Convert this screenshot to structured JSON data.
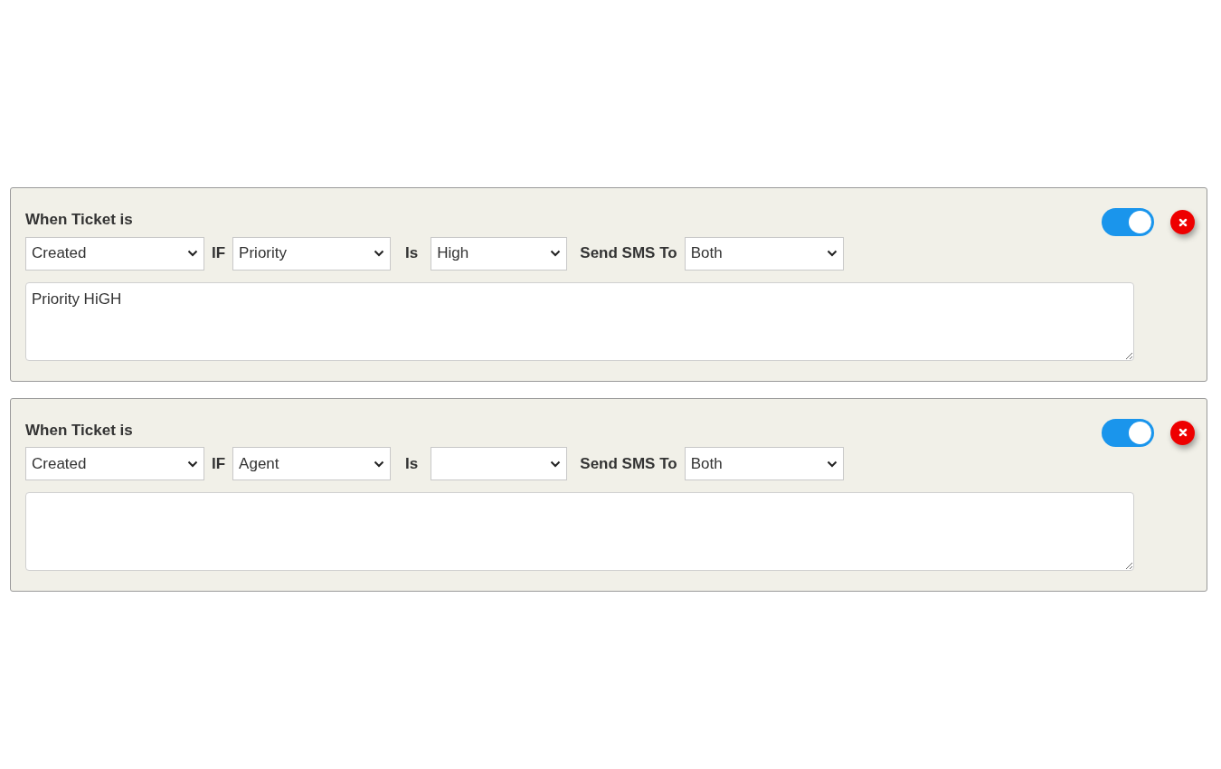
{
  "rules": [
    {
      "heading": "When Ticket is",
      "event": "Created",
      "if_label": "IF",
      "field": "Priority",
      "is_label": "Is",
      "value": "High",
      "send_label": "Send SMS To",
      "recipient": "Both",
      "message": "Priority HiGH",
      "enabled": true
    },
    {
      "heading": "When Ticket is",
      "event": "Created",
      "if_label": "IF",
      "field": "Agent",
      "is_label": "Is",
      "send_label": "Send SMS To",
      "recipient": "Both",
      "enabled": true
    }
  ]
}
